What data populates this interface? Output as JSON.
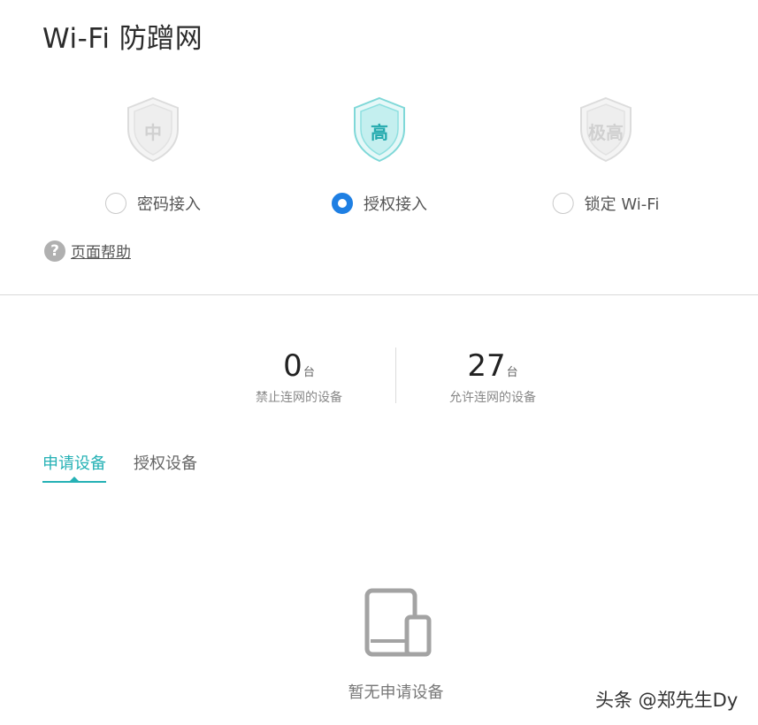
{
  "page": {
    "title": "Wi-Fi 防蹭网"
  },
  "levels": [
    {
      "shield_text": "中",
      "option_label": "密码接入",
      "selected": false,
      "color": "#d8d8d8"
    },
    {
      "shield_text": "高",
      "option_label": "授权接入",
      "selected": true,
      "color": "#25b1b5"
    },
    {
      "shield_text": "极高",
      "option_label": "锁定 Wi-Fi",
      "selected": false,
      "color": "#d8d8d8"
    }
  ],
  "help": {
    "icon_glyph": "?",
    "label": "页面帮助"
  },
  "stats": [
    {
      "value": "0",
      "unit": "台",
      "label": "禁止连网的设备"
    },
    {
      "value": "27",
      "unit": "台",
      "label": "允许连网的设备"
    }
  ],
  "tabs": [
    {
      "label": "申请设备",
      "active": true
    },
    {
      "label": "授权设备",
      "active": false
    }
  ],
  "empty_state": {
    "icon": "tablet-phone-icon",
    "text": "暂无申请设备"
  },
  "watermark": {
    "text": "头条 @郑先生Dy"
  },
  "colors": {
    "accent": "#25b1b5",
    "radio_selected": "#1e7fe3",
    "inactive": "#d8d8d8"
  }
}
